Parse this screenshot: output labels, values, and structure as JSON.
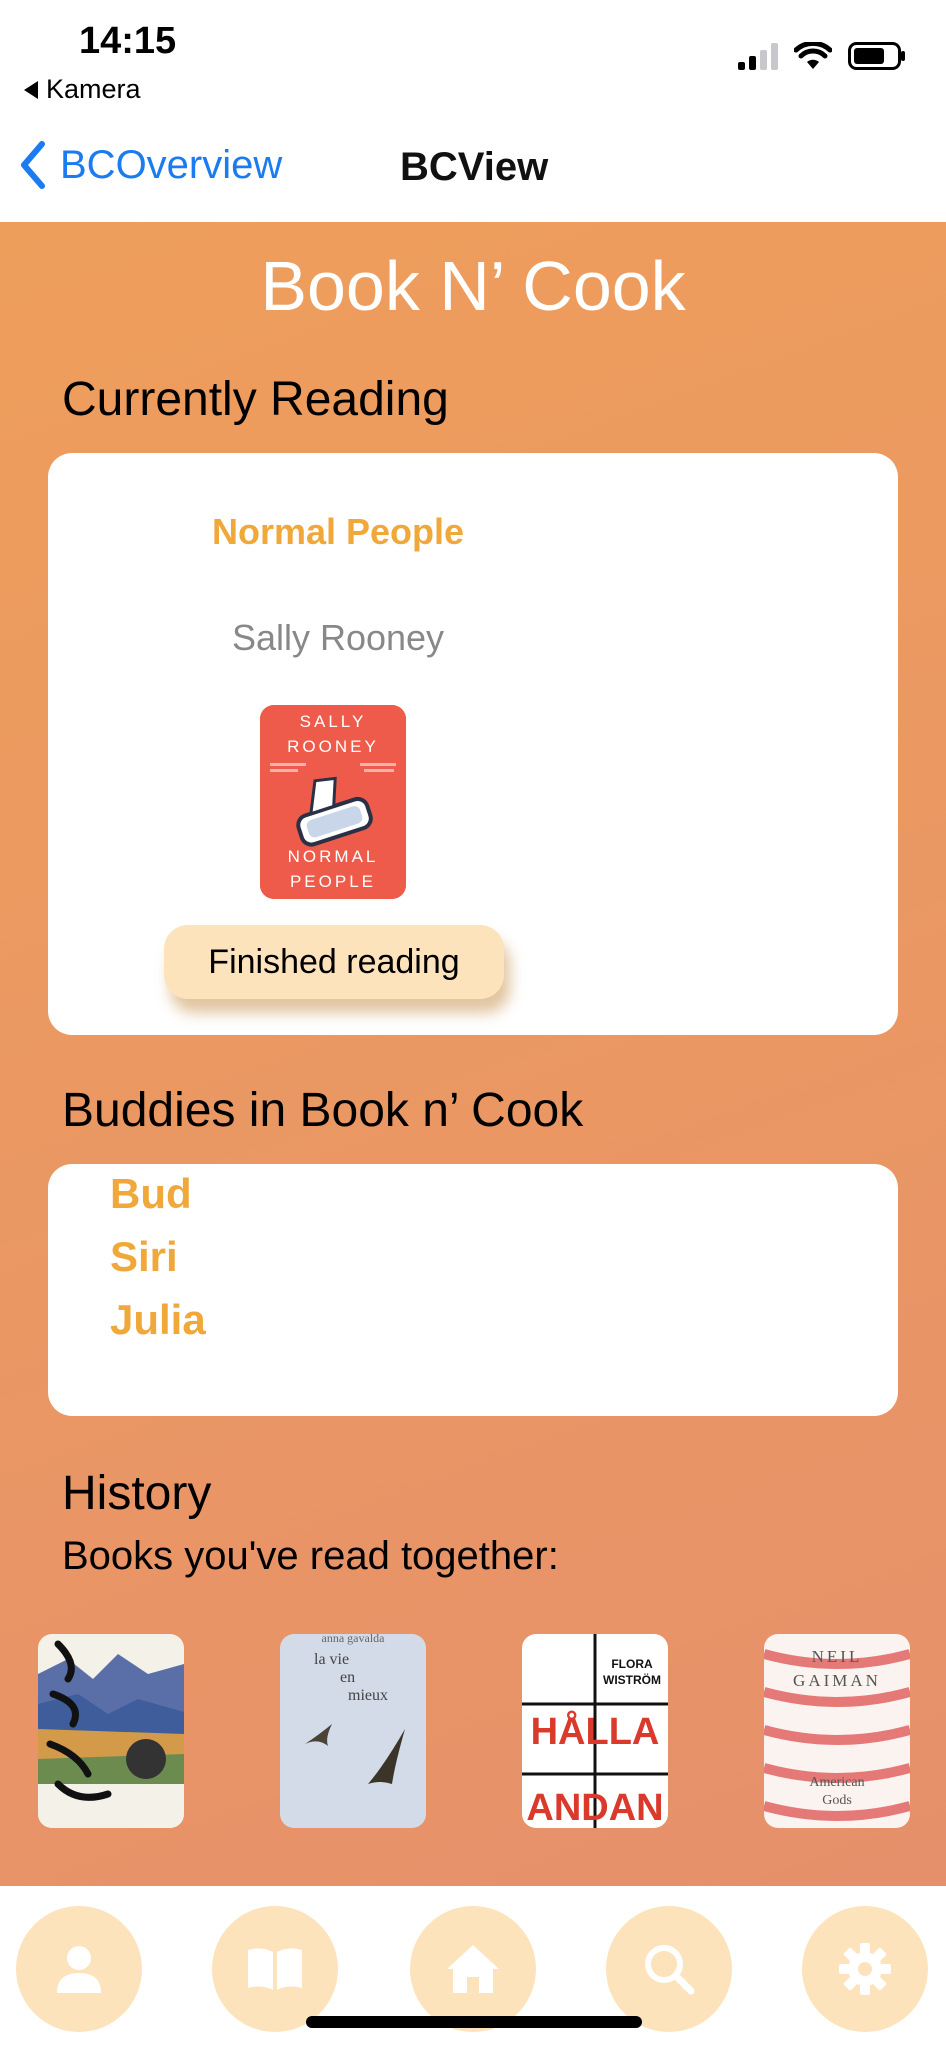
{
  "status_bar": {
    "time": "14:15",
    "back_app": "Kamera"
  },
  "nav": {
    "back_label": "BCOverview",
    "title": "BCView"
  },
  "app_title": "Book N’ Cook",
  "currently_reading": {
    "heading": "Currently Reading",
    "book_title": "Normal People",
    "author": "Sally Rooney",
    "cover": {
      "top": "SALLY ROONEY",
      "bottom": "NORMAL PEOPLE",
      "color": "#ee5b4a"
    },
    "finished_button": "Finished reading"
  },
  "buddies": {
    "heading": "Buddies in Book n’ Cook",
    "names": [
      "Bud",
      "Siri",
      "Julia"
    ]
  },
  "history": {
    "heading": "History",
    "subheading": "Books you've read together:",
    "books": [
      {
        "icon": "jag-for-henne-till-bron-cover"
      },
      {
        "author": "anna gavalda",
        "title": "la vie en mieux"
      },
      {
        "author": "FLORA WISTRÖM",
        "title_top": "HÅLLA",
        "title_bottom": "ANDAN"
      },
      {
        "author": "NEIL GAIMAN",
        "title": "American Gods"
      }
    ]
  },
  "tabs": [
    {
      "icon": "person-icon"
    },
    {
      "icon": "book-icon"
    },
    {
      "icon": "home-icon"
    },
    {
      "icon": "search-icon"
    },
    {
      "icon": "gear-icon"
    }
  ],
  "colors": {
    "accent": "#f0a83a",
    "link": "#1a7cf0",
    "tab_bg": "#fde3bb",
    "gradient_start": "#ee9e5b",
    "gradient_end": "#e6906b"
  }
}
